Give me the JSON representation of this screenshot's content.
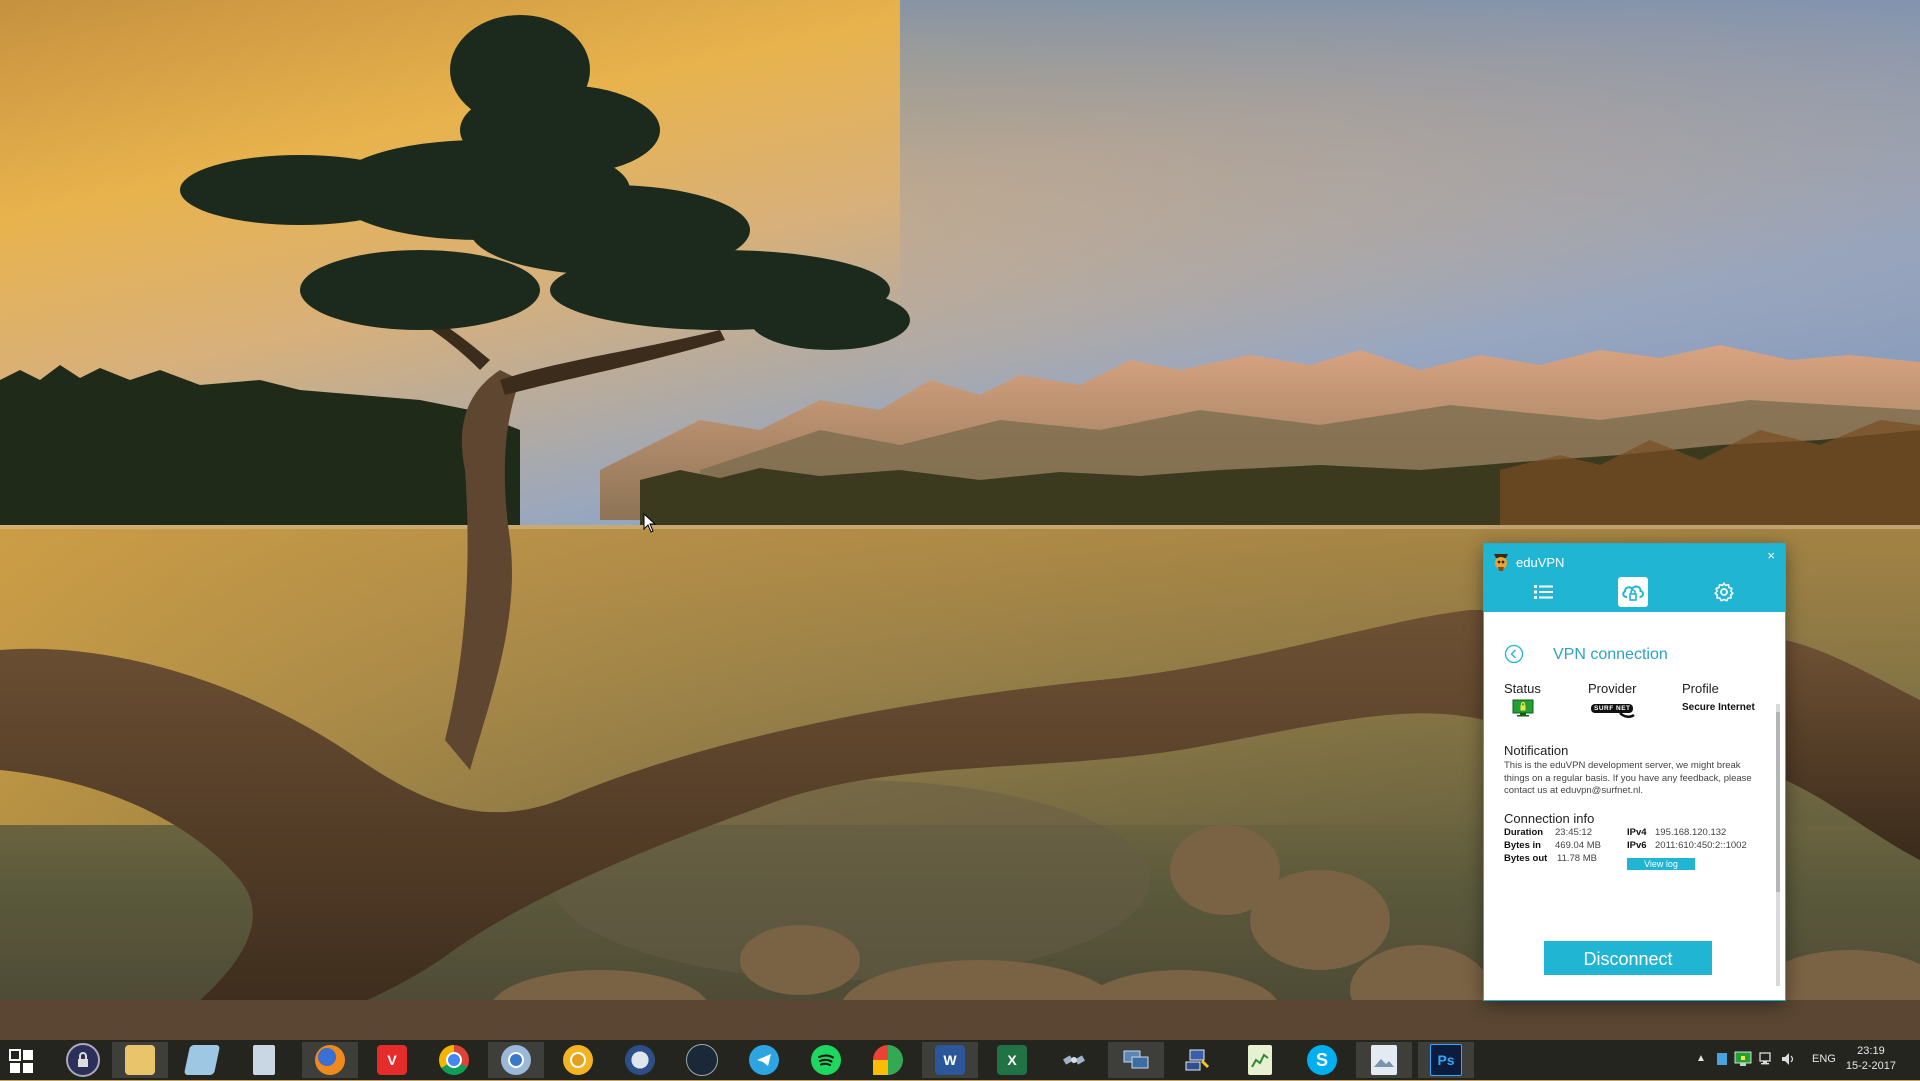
{
  "window": {
    "title": "eduVPN",
    "close_glyph": "×",
    "heading": "VPN connection",
    "status_label": "Status",
    "provider_label": "Provider",
    "profile_label": "Profile",
    "profile_value": "Secure Internet",
    "provider_logo_text": "SURF NET",
    "notification_title": "Notification",
    "notification_text": "This is the eduVPN development server, we might break things on a regular basis. If you have any feedback, please contact us at eduvpn@surfnet.nl.",
    "connection_title": "Connection info",
    "duration_label": "Duration",
    "duration_value": "23:45:12",
    "bytes_in_label": "Bytes in",
    "bytes_in_value": "469.04 MB",
    "bytes_out_label": "Bytes out",
    "bytes_out_value": "11.78 MB",
    "ipv4_label": "IPv4",
    "ipv4_value": "195.168.120.132",
    "ipv6_label": "IPv6",
    "ipv6_value": "2011:610:450:2::1002",
    "view_log_label": "View log",
    "disconnect_label": "Disconnect",
    "accent_color": "#21b5d4"
  },
  "taskbar": {
    "apps": [
      {
        "name": "start",
        "icon": "windows-start-icon"
      },
      {
        "name": "keepass",
        "icon": "lock-icon"
      },
      {
        "name": "file-explorer",
        "icon": "folder-icon"
      },
      {
        "name": "notepad",
        "icon": "notepad-icon"
      },
      {
        "name": "calculator",
        "icon": "calculator-icon"
      },
      {
        "name": "firefox",
        "icon": "firefox-icon"
      },
      {
        "name": "vivaldi",
        "icon": "vivaldi-icon",
        "glyph": "V"
      },
      {
        "name": "chrome",
        "icon": "chrome-icon"
      },
      {
        "name": "chrome-dev",
        "icon": "chrome-dev-icon"
      },
      {
        "name": "chrome-canary",
        "icon": "chrome-canary-icon"
      },
      {
        "name": "thunderbird",
        "icon": "thunderbird-icon"
      },
      {
        "name": "steam",
        "icon": "steam-icon"
      },
      {
        "name": "telegram",
        "icon": "telegram-icon"
      },
      {
        "name": "spotify",
        "icon": "spotify-icon"
      },
      {
        "name": "maps",
        "icon": "maps-icon"
      },
      {
        "name": "word",
        "icon": "word-icon",
        "glyph": "W"
      },
      {
        "name": "excel",
        "icon": "excel-icon",
        "glyph": "X"
      },
      {
        "name": "satellite",
        "icon": "satellite-icon"
      },
      {
        "name": "remote-desktop",
        "icon": "remote-desktop-icon"
      },
      {
        "name": "network-tool",
        "icon": "network-tool-icon"
      },
      {
        "name": "task-manager",
        "icon": "chart-icon"
      },
      {
        "name": "skype",
        "icon": "skype-icon",
        "glyph": "S"
      },
      {
        "name": "photo-viewer",
        "icon": "photos-icon"
      },
      {
        "name": "photoshop",
        "icon": "photoshop-icon",
        "glyph": "Ps"
      }
    ],
    "tray": {
      "language": "ENG",
      "time": "23:19",
      "date": "15-2-2017"
    }
  }
}
